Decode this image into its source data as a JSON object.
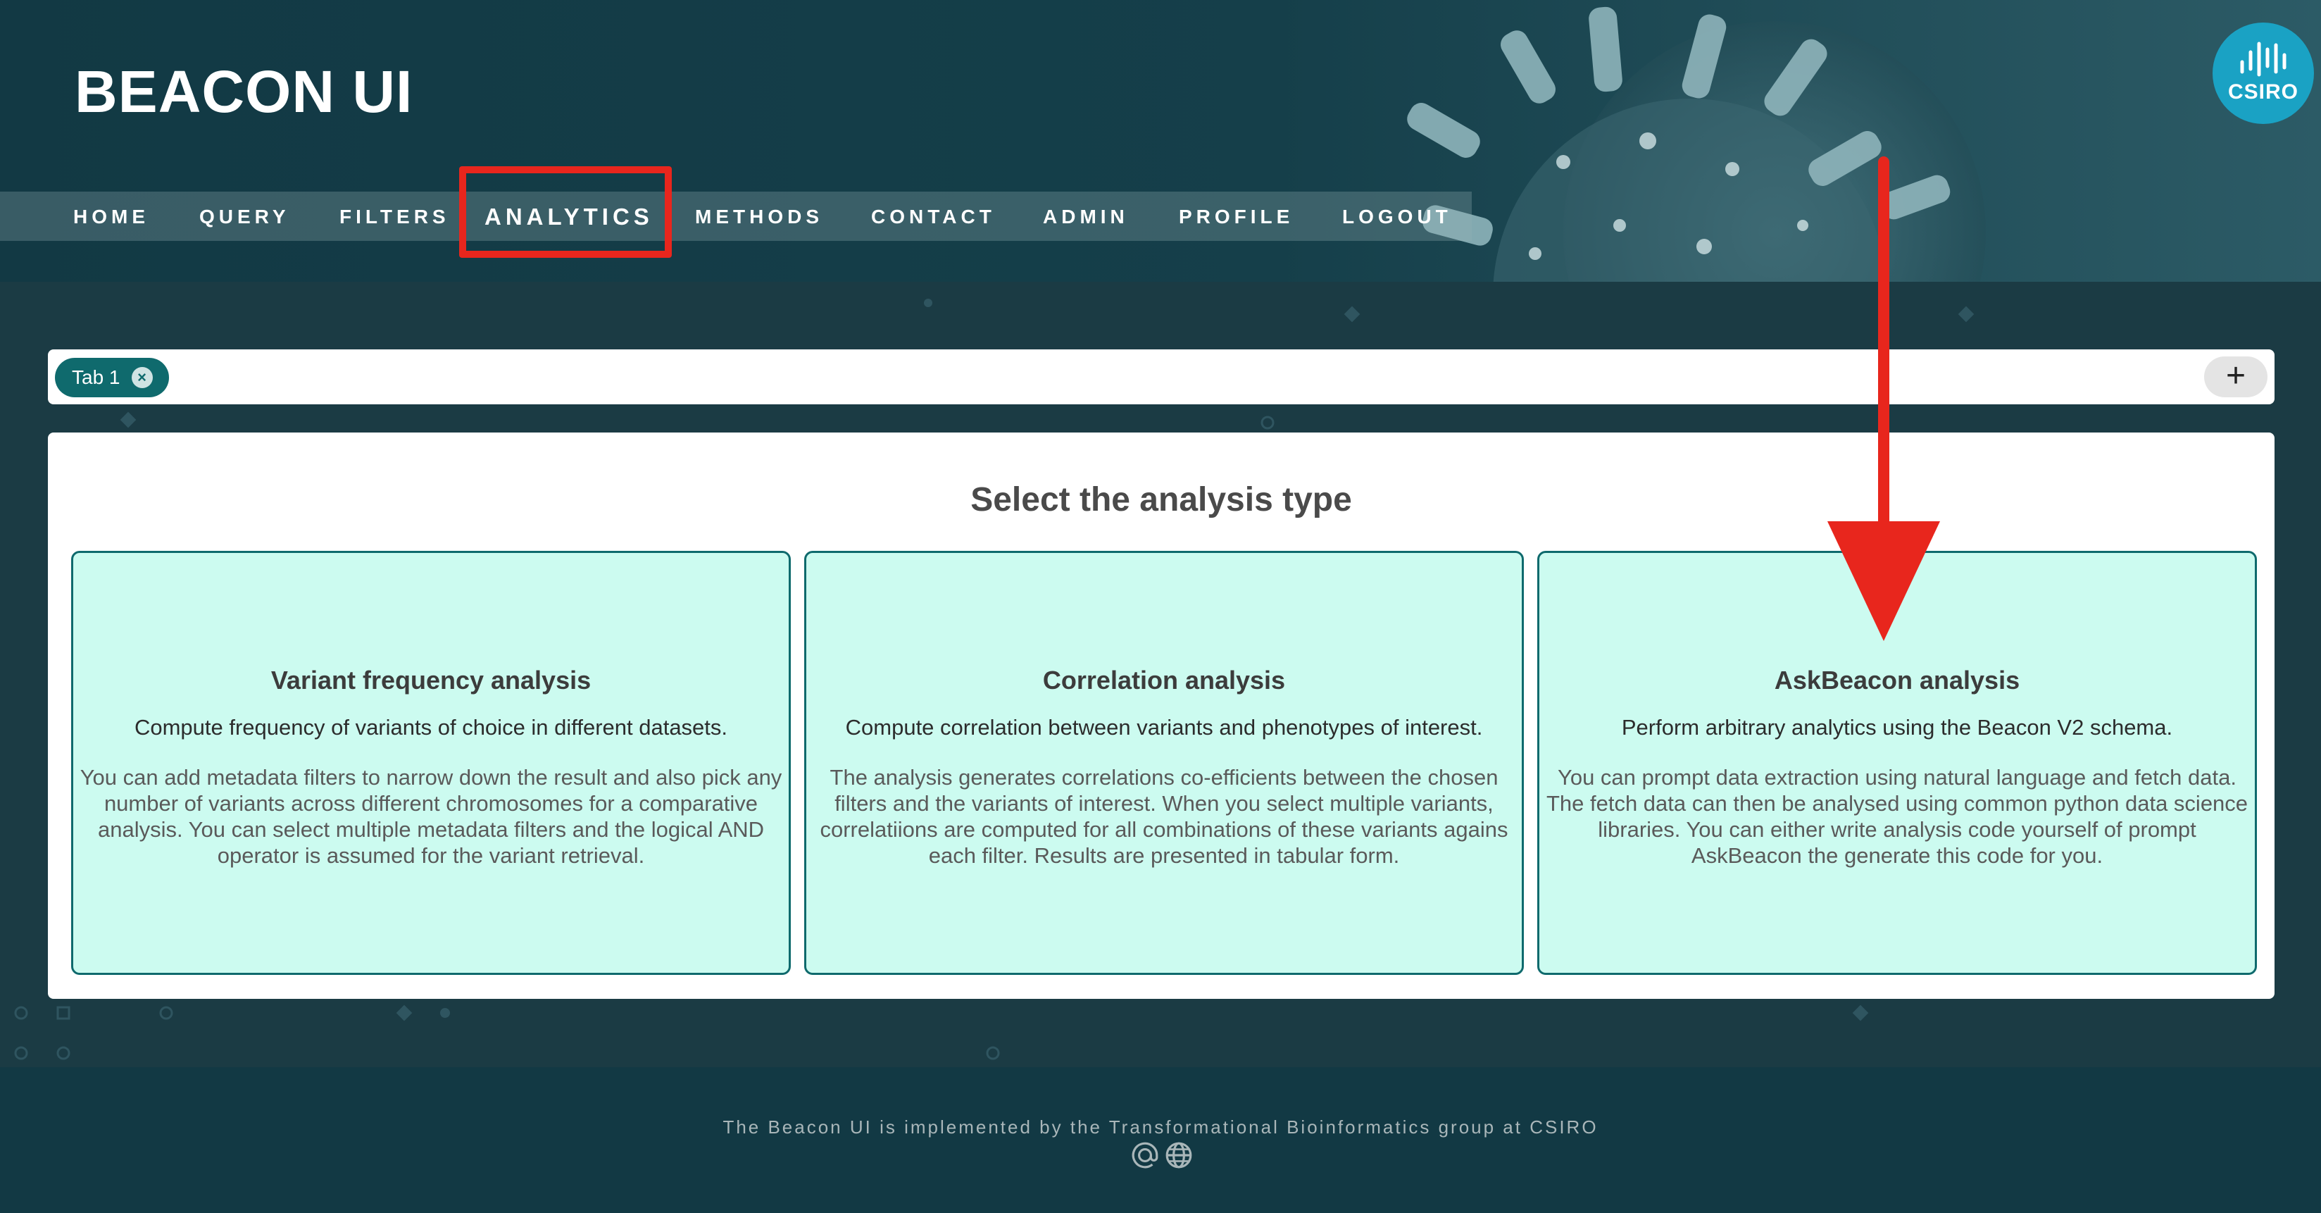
{
  "app": {
    "title": "BEACON UI",
    "logo_text": "CSIRO"
  },
  "nav": {
    "items": [
      {
        "label": "HOME"
      },
      {
        "label": "QUERY"
      },
      {
        "label": "FILTERS"
      },
      {
        "label": "ANALYTICS",
        "active": true
      },
      {
        "label": "METHODS"
      },
      {
        "label": "CONTACT"
      },
      {
        "label": "ADMIN"
      },
      {
        "label": "PROFILE"
      },
      {
        "label": "LOGOUT"
      }
    ]
  },
  "tabs": {
    "items": [
      {
        "label": "Tab 1",
        "close_icon": "close-circle-icon"
      }
    ],
    "add_label": "+"
  },
  "main": {
    "title": "Select the analysis type",
    "cards": [
      {
        "title": "Variant frequency analysis",
        "subtitle": "Compute frequency of variants of choice in different datasets.",
        "description": "You can add metadata filters to narrow down the result and also pick any number of variants across different chromosomes for a comparative analysis. You can select multiple metadata filters and the logical AND operator is assumed for the variant retrieval."
      },
      {
        "title": "Correlation analysis",
        "subtitle": "Compute correlation between variants and phenotypes of interest.",
        "description": "The analysis generates correlations co-efficients between the chosen filters and the variants of interest. When you select multiple variants, correlatiions are computed for all combinations of these variants agains each filter. Results are presented in tabular form."
      },
      {
        "title": "AskBeacon analysis",
        "subtitle": "Perform arbitrary analytics using the Beacon V2 schema.",
        "description": "You can prompt data extraction using natural language and fetch data. The fetch data can then be analysed using common python data science libraries. You can either write analysis code yourself of prompt AskBeacon the generate this code for you."
      }
    ]
  },
  "footer": {
    "text": "The Beacon UI is implemented by the Transformational Bioinformatics group at CSIRO",
    "icons": [
      "at-icon",
      "globe-icon"
    ]
  },
  "colors": {
    "header_bg": "#123944",
    "accent_teal": "#0f6a6d",
    "card_bg": "#ccfbf0",
    "highlight_red": "#e8261d",
    "logo_blue": "#1aa2c4"
  }
}
